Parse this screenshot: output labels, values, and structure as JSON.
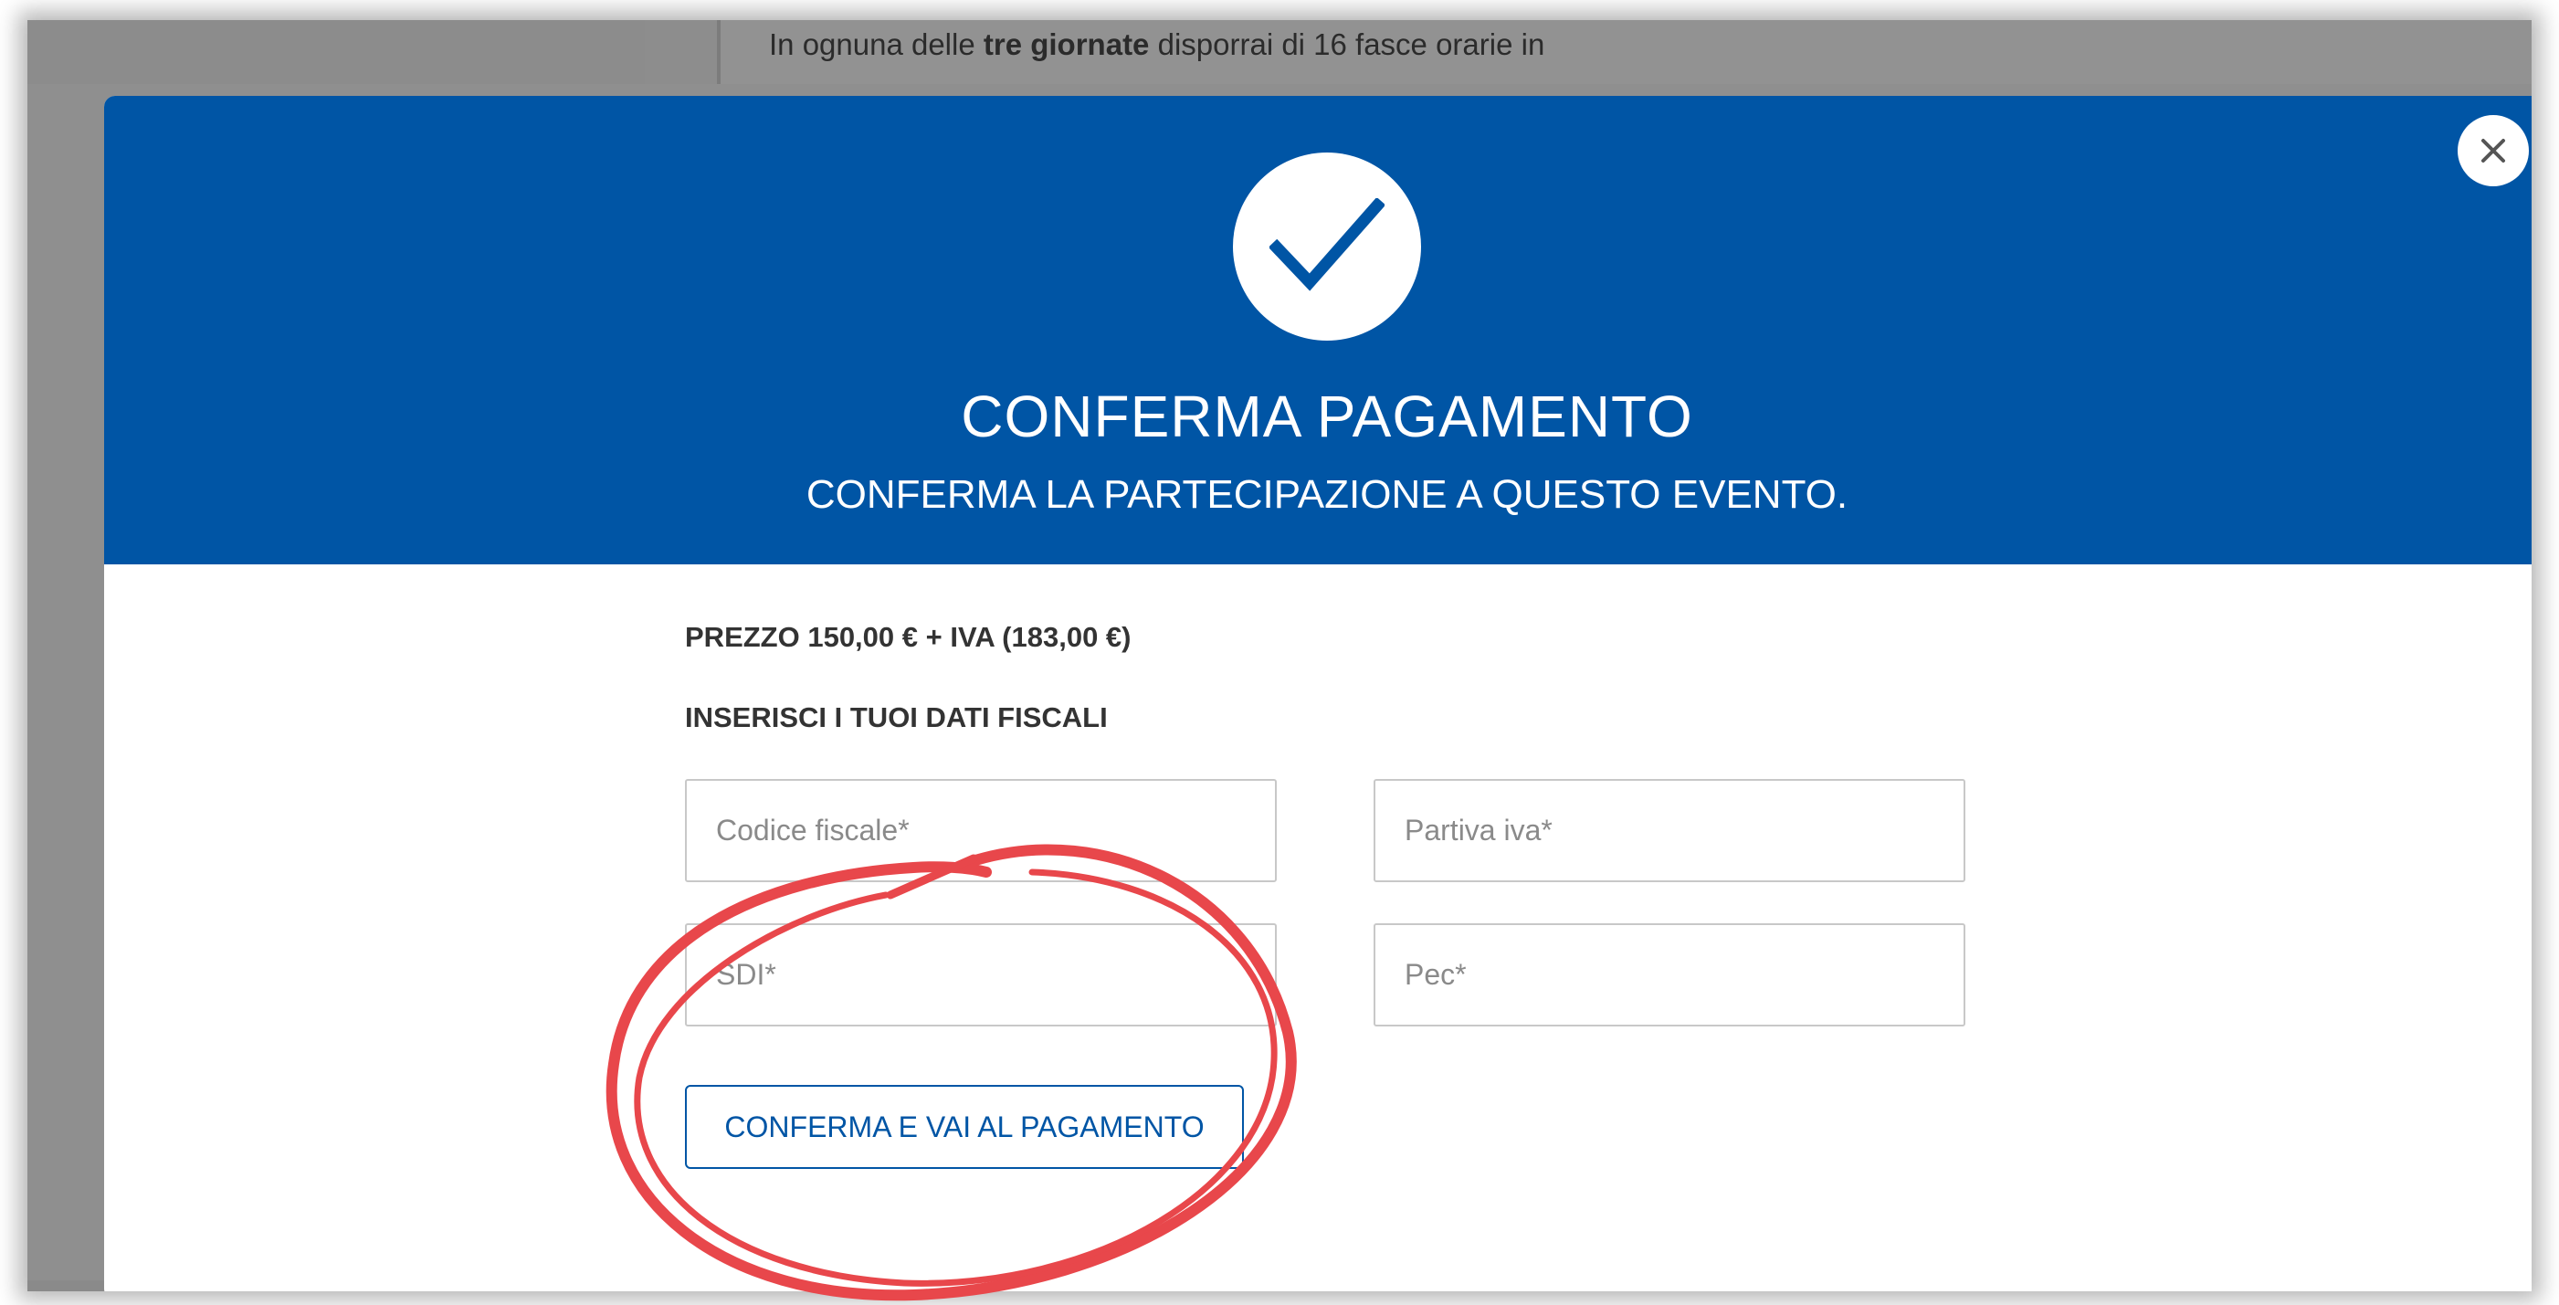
{
  "background": {
    "text_before": "In ognuna delle ",
    "text_bold": "tre giornate",
    "text_after": " disporrai di 16 fasce orarie in"
  },
  "modal": {
    "title": "CONFERMA PAGAMENTO",
    "subtitle": "CONFERMA LA PARTECIPAZIONE A QUESTO EVENTO.",
    "header_color": "#0055a5",
    "close_icon": "close-icon",
    "status_icon": "checkmark-icon"
  },
  "form": {
    "price": "PREZZO 150,00 € + IVA (183,00 €)",
    "heading": "INSERISCI I TUOI DATI FISCALI",
    "fields": {
      "codice_fiscale_placeholder": "Codice fiscale*",
      "partita_iva_placeholder": "Partiva iva*",
      "sdi_placeholder": "SDI*",
      "pec_placeholder": "Pec*"
    },
    "submit_label": "CONFERMA E VAI AL PAGAMENTO"
  },
  "annotation": {
    "shape": "hand-drawn-circle",
    "color": "#e8474b"
  }
}
